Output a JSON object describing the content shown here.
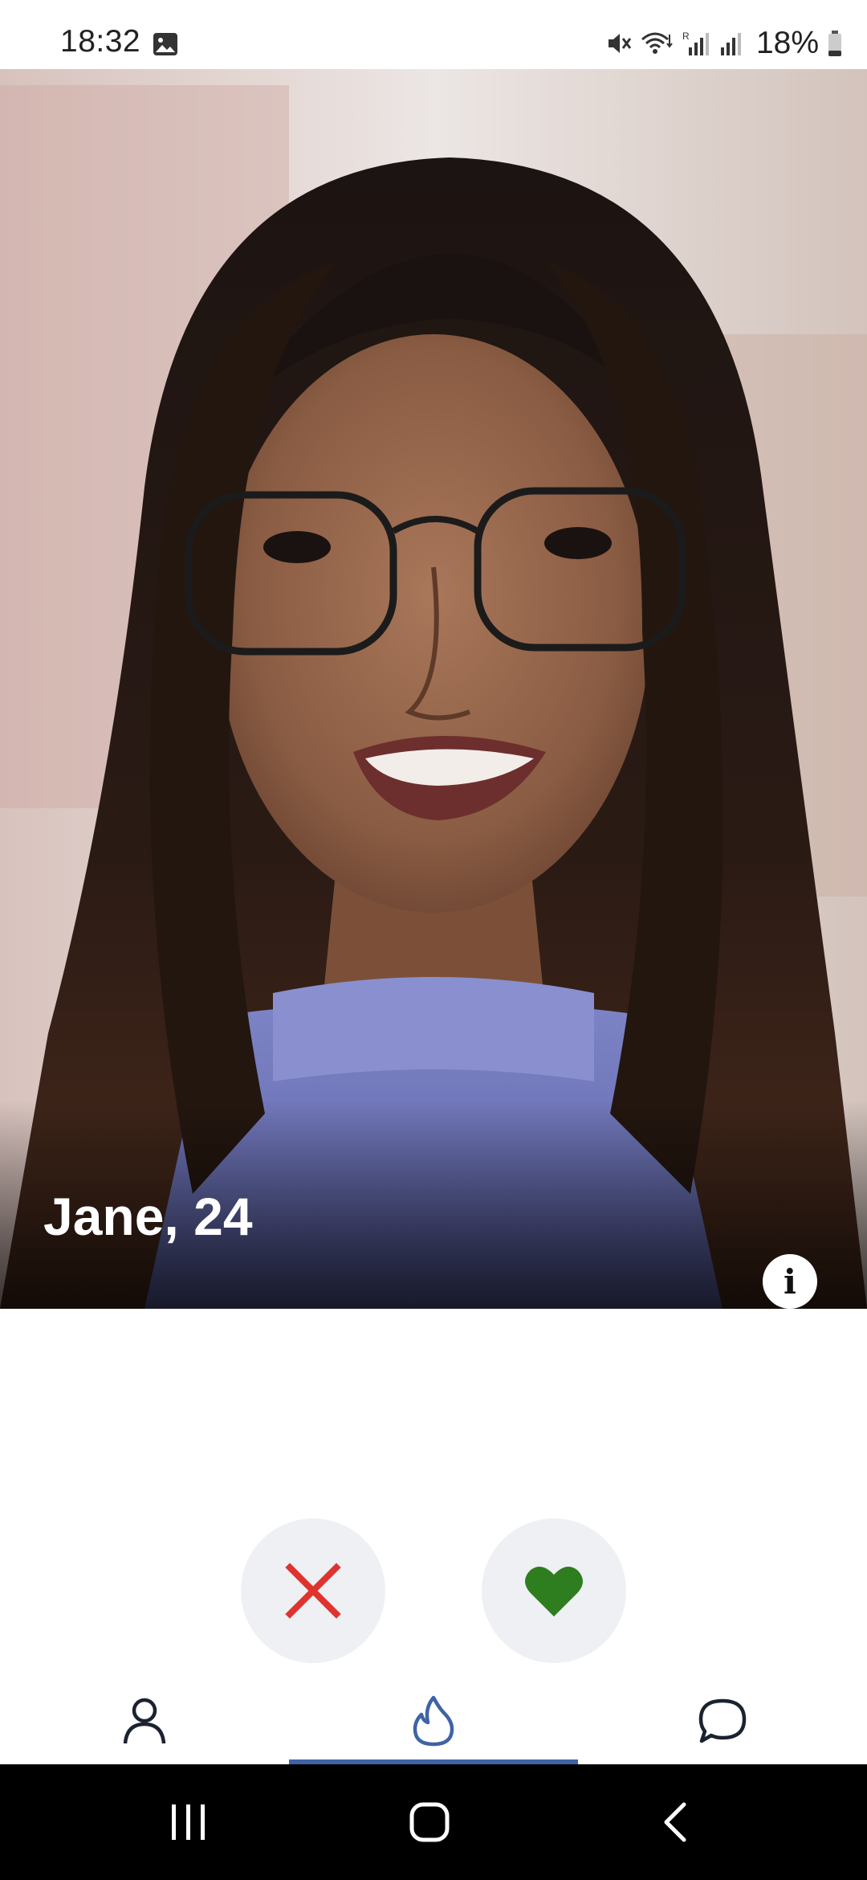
{
  "status_bar": {
    "time": "18:32",
    "battery": "18%",
    "icons": [
      "gallery-icon",
      "mute-icon",
      "wifi-icon",
      "signal-r-icon",
      "signal-icon",
      "battery-icon"
    ]
  },
  "profile": {
    "name_age": "Jane, 24",
    "info_glyph": "i"
  },
  "actions": {
    "dislike_icon": "close-icon",
    "like_icon": "heart-icon",
    "dislike_color": "#e0332d",
    "like_color": "#2e7d1f"
  },
  "tabs": [
    {
      "icon": "person-icon",
      "active": false
    },
    {
      "icon": "flame-icon",
      "active": true
    },
    {
      "icon": "chat-bubble-icon",
      "active": false
    }
  ],
  "colors": {
    "accent": "#3f63a6",
    "action_bg": "#eef0f4",
    "nav_bar": "#000000"
  }
}
